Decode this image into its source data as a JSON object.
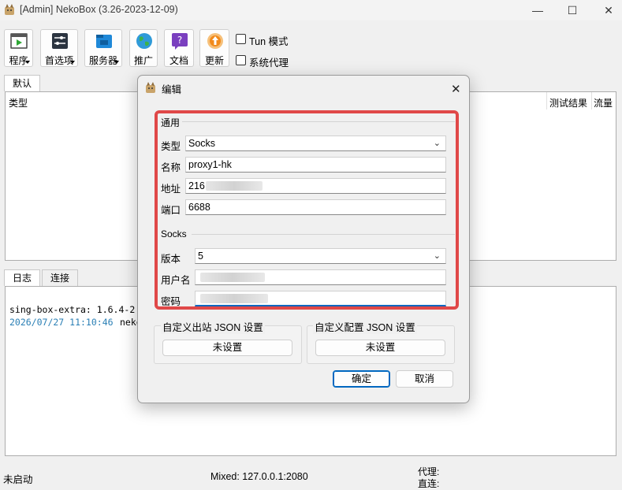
{
  "window": {
    "title": "[Admin] NekoBox (3.26-2023-12-09)",
    "minimize_glyph": "—",
    "maximize_glyph": "☐",
    "close_glyph": "✕"
  },
  "toolbar": {
    "buttons": [
      {
        "label": "程序",
        "icon": "program-icon",
        "color": "#3a8e3a"
      },
      {
        "label": "首选项",
        "icon": "preferences-icon",
        "color": "#2b3440"
      },
      {
        "label": "服务器",
        "icon": "server-icon",
        "color": "#1e88d8"
      },
      {
        "label": "推广",
        "icon": "globe-icon",
        "color": "#2f9ad8"
      },
      {
        "label": "文档",
        "icon": "document-icon",
        "color": "#7a3fbf"
      },
      {
        "label": "更新",
        "icon": "update-icon",
        "color": "#f28a1a"
      }
    ],
    "tun_mode": {
      "label": "Tun 模式",
      "checked": false
    },
    "system_proxy": {
      "label": "系统代理",
      "checked": false
    }
  },
  "groups": {
    "tab_default": "默认",
    "columns": {
      "type": "类型",
      "test_result": "测试结果",
      "traffic": "流量"
    }
  },
  "log_area": {
    "tab_log": "日志",
    "tab_connections": "连接",
    "line1": "sing-box-extra: 1.6.4-2",
    "line2_time": "2026/07/27 11:10:46",
    "line2_text": "neko"
  },
  "status_bar": {
    "state": "未启动",
    "mixed": "Mixed: 127.0.0.1:2080",
    "proxy": "代理:",
    "direct": "直连:"
  },
  "dialog": {
    "title": "编辑",
    "close_glyph": "✕",
    "general": {
      "heading": "通用",
      "type_label": "类型",
      "type_value": "Socks",
      "name_label": "名称",
      "name_value": "proxy1-hk",
      "address_label": "地址",
      "address_value": "216",
      "port_label": "端口",
      "port_value": "6688"
    },
    "socks": {
      "heading": "Socks",
      "version_label": "版本",
      "version_value": "5",
      "username_label": "用户名",
      "password_label": "密码"
    },
    "custom_outbound": {
      "label": "自定义出站 JSON 设置",
      "button": "未设置"
    },
    "custom_config": {
      "label": "自定义配置 JSON 设置",
      "button": "未设置"
    },
    "ok_button": "确定",
    "cancel_button": "取消",
    "highlight_color": "#e04848"
  }
}
